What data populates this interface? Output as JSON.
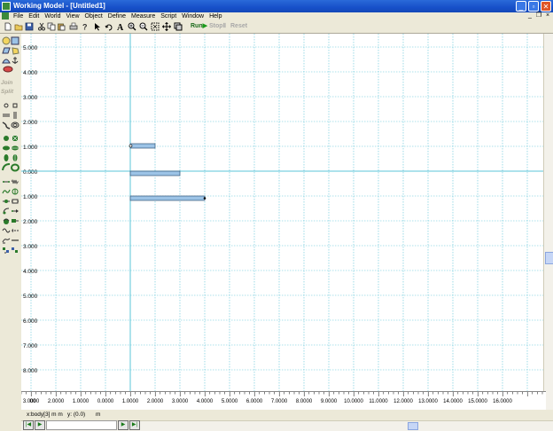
{
  "window": {
    "title": "Working Model - [Untitled1]"
  },
  "menus": [
    "File",
    "Edit",
    "World",
    "View",
    "Object",
    "Define",
    "Measure",
    "Script",
    "Window",
    "Help"
  ],
  "toolbar": {
    "run_label": "Run",
    "stop_label": "Stop",
    "reset_label": "Reset"
  },
  "palette": {
    "join_label": "Join",
    "split_label": "Split"
  },
  "y_axis_labels": [
    "5.000",
    "4.000",
    "3.000",
    "2.000",
    "1.000",
    "0.000",
    "1.000",
    "2.000",
    "3.000",
    "4.000",
    "5.000",
    "6.000",
    "7.000",
    "8.000"
  ],
  "x_axis_labels": [
    "00",
    "3.0000",
    "2.0000",
    "1.0000",
    "0.0000",
    "1.0000",
    "2.0000",
    "3.0000",
    "4.0000",
    "5.0000",
    "6.0000",
    "7.0000",
    "8.0000",
    "9.0000",
    "10.0000",
    "11.0000",
    "12.0000",
    "13.0000",
    "14.0000",
    "15.0000",
    "16.0000"
  ],
  "status": {
    "x_field": "x:body[3] m  m",
    "y_field": "y: (0.0)",
    "unit": "m"
  },
  "colors": {
    "grid": "#5bc4d8",
    "body_fill": "#9cc3e6",
    "body_stroke": "#335577",
    "title_bar": "#1750c9"
  }
}
